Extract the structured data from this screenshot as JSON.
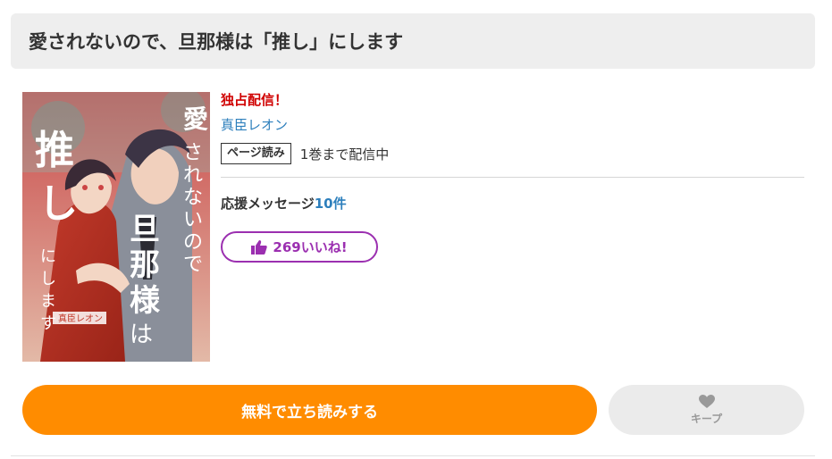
{
  "header": {
    "title": "愛されないので、旦那様は「推し」にします"
  },
  "cover": {
    "title_line1": "愛されないので、",
    "title_line2": "旦那様は",
    "title_line3": "「推し」にします",
    "author": "真臣レオン"
  },
  "info": {
    "exclusive_label": "独占配信！",
    "author": "真臣レオン",
    "format_tag": "ページ読み",
    "distribution": "1巻まで配信中",
    "support_label": "応援メッセージ",
    "support_count": "10件",
    "like_count": "269",
    "like_suffix": "いいね!"
  },
  "actions": {
    "read_free_label": "無料で立ち読みする",
    "keep_label": "キープ"
  },
  "colors": {
    "accent_orange": "#ff8c00",
    "link_blue": "#2d7fbc",
    "exclusive_red": "#d00000",
    "like_purple": "#9b2fb0"
  }
}
